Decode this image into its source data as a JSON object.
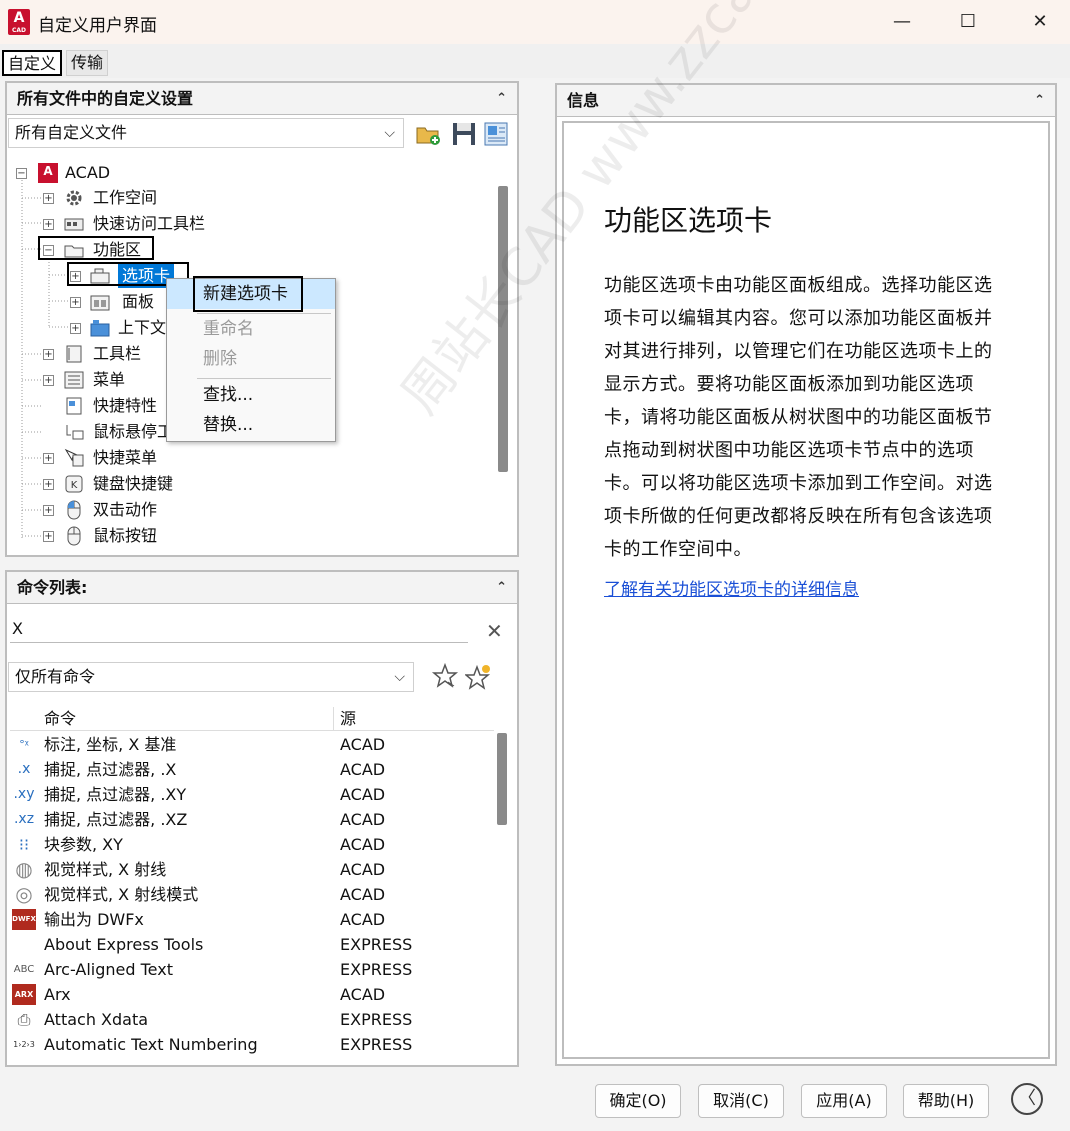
{
  "window": {
    "title": "自定义用户界面",
    "app_icon_letter": "A",
    "app_icon_sub": "CAD",
    "minimize_glyph": "—",
    "maximize_glyph": "☐",
    "close_glyph": "✕"
  },
  "tabs": [
    {
      "label": "自定义"
    },
    {
      "label": "传输"
    }
  ],
  "customizations_panel": {
    "title": "所有文件中的自定义设置",
    "collapse_glyph": "⌃",
    "file_filter": "所有自定义文件",
    "tree": {
      "root": "ACAD",
      "items": [
        {
          "label": "工作空间",
          "icon": "gear-icon"
        },
        {
          "label": "快速访问工具栏",
          "icon": "quick-access-toolbar-icon"
        },
        {
          "label": "功能区",
          "icon": "ribbon-folder-icon"
        },
        {
          "label": "选项卡",
          "icon": "ribbon-tab-icon"
        },
        {
          "label": "面板",
          "icon": "ribbon-panel-icon"
        },
        {
          "label": "上下文",
          "icon": "contextual-tab-icon"
        },
        {
          "label": "工具栏",
          "icon": "toolbar-icon"
        },
        {
          "label": "菜单",
          "icon": "menu-icon"
        },
        {
          "label": "快捷特性",
          "icon": "quick-properties-icon"
        },
        {
          "label": "鼠标悬停工",
          "icon": "rollover-tooltip-icon"
        },
        {
          "label": "快捷菜单",
          "icon": "shortcut-menu-icon"
        },
        {
          "label": "键盘快捷键",
          "icon": "keyboard-shortcut-icon"
        },
        {
          "label": "双击动作",
          "icon": "double-click-icon"
        },
        {
          "label": "鼠标按钮",
          "icon": "mouse-button-icon"
        }
      ]
    }
  },
  "context_menu": {
    "items": [
      {
        "label": "新建选项卡",
        "enabled": true
      },
      {
        "label": "重命名",
        "enabled": false
      },
      {
        "label": "删除",
        "enabled": false
      },
      {
        "label": "查找...",
        "enabled": true
      },
      {
        "label": "替换...",
        "enabled": true
      }
    ]
  },
  "command_panel": {
    "title": "命令列表:",
    "collapse_glyph": "⌃",
    "search_value": "X",
    "clear_glyph": "✕",
    "filter": "仅所有命令",
    "columns": {
      "command": "命令",
      "source": "源"
    },
    "rows": [
      {
        "icon_text": "°ᵡ",
        "name": "标注, 坐标, X 基准",
        "source": "ACAD"
      },
      {
        "icon_text": ".x",
        "name": "捕捉, 点过滤器, .X",
        "source": "ACAD"
      },
      {
        "icon_text": ".xy",
        "name": "捕捉, 点过滤器, .XY",
        "source": "ACAD"
      },
      {
        "icon_text": ".xz",
        "name": "捕捉, 点过滤器, .XZ",
        "source": "ACAD"
      },
      {
        "icon_text": "⁝⁝",
        "name": "块参数, XY",
        "source": "ACAD"
      },
      {
        "icon_text": "◍",
        "name": "视觉样式, X 射线",
        "source": "ACAD"
      },
      {
        "icon_text": "◎",
        "name": "视觉样式, X 射线模式",
        "source": "ACAD"
      },
      {
        "icon_text": "DWFX",
        "name": "输出为 DWFx",
        "source": "ACAD"
      },
      {
        "icon_text": "",
        "name": "About Express Tools",
        "source": "EXPRESS"
      },
      {
        "icon_text": "ABC",
        "name": "Arc-Aligned Text",
        "source": "EXPRESS"
      },
      {
        "icon_text": "ARX",
        "name": "Arx",
        "source": "ACAD"
      },
      {
        "icon_text": "⎙",
        "name": "Attach Xdata",
        "source": "EXPRESS"
      },
      {
        "icon_text": "1›2›3",
        "name": "Automatic Text Numbering",
        "source": "EXPRESS"
      }
    ]
  },
  "info_panel": {
    "title": "信息",
    "collapse_glyph": "⌃",
    "heading": "功能区选项卡",
    "body": "功能区选项卡由功能区面板组成。选择功能区选项卡可以编辑其内容。您可以添加功能区面板并对其进行排列，以管理它们在功能区选项卡上的显示方式。要将功能区面板添加到功能区选项卡，请将功能区面板从树状图中的功能区面板节点拖动到树状图中功能区选项卡节点中的选项卡。可以将功能区选项卡添加到工作空间。对选项卡所做的任何更改都将反映在所有包含该选项卡的工作空间中。",
    "link": "了解有关功能区选项卡的详细信息"
  },
  "buttons": {
    "ok": "确定(O)",
    "cancel": "取消(C)",
    "apply": "应用(A)",
    "help": "帮助(H)",
    "collapse_glyph": "〈"
  },
  "watermark": "周站长CAD www.zzcad.com",
  "colors": {
    "selection": "#0078d7",
    "menu_highlight": "#cce8ff",
    "link": "#1a4fd6",
    "autocad_red": "#c8102e"
  }
}
